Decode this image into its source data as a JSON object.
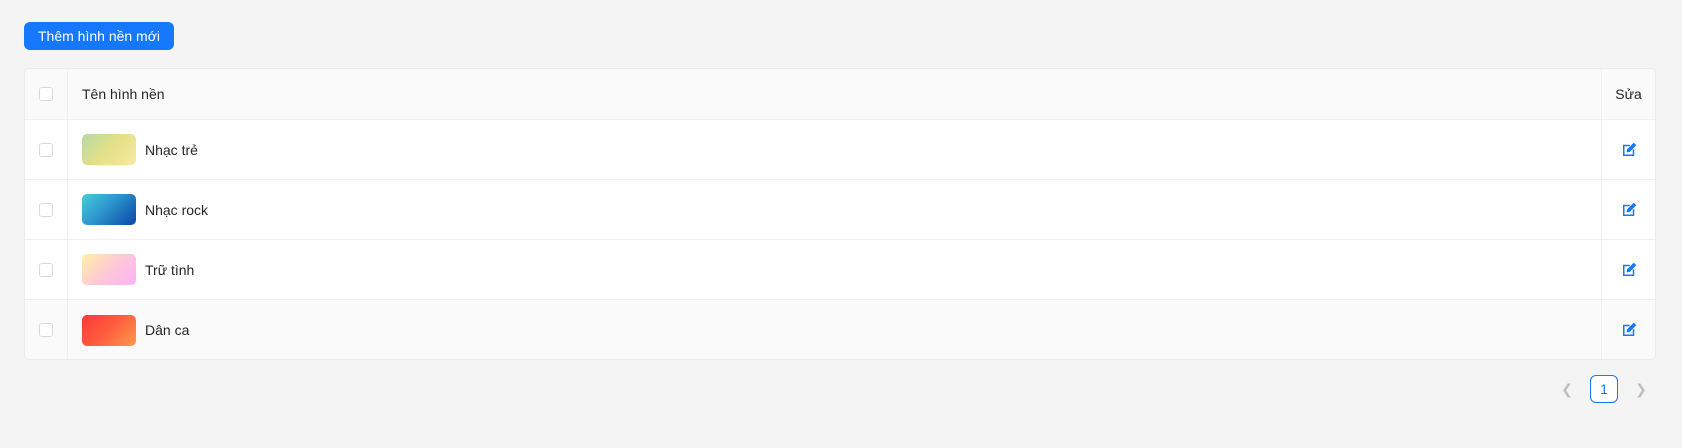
{
  "toolbar": {
    "add_label": "Thêm hình nền mới"
  },
  "table": {
    "headers": {
      "name": "Tên hình nền",
      "edit": "Sửa"
    },
    "rows": [
      {
        "name": "Nhạc trẻ",
        "gradient": [
          "#b5dba4",
          "#e5e088",
          "#f6e9a1"
        ]
      },
      {
        "name": "Nhạc rock",
        "gradient": [
          "#49cce0",
          "#2a8ec9",
          "#0a45a8"
        ]
      },
      {
        "name": "Trữ tình",
        "gradient": [
          "#fff0a4",
          "#ffc9d6",
          "#fdb2f6"
        ]
      },
      {
        "name": "Dân ca",
        "gradient": [
          "#ff3737",
          "#ff5e3e",
          "#ff9a4d"
        ]
      }
    ]
  },
  "pagination": {
    "current": "1"
  },
  "colors": {
    "accent": "#1677ff"
  }
}
